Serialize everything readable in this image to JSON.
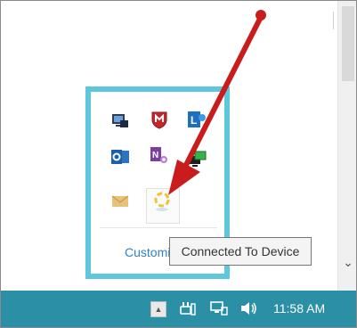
{
  "popup": {
    "customize_label": "Customize",
    "icons": [
      {
        "name": "screen-share-icon"
      },
      {
        "name": "mcafee-shield-icon"
      },
      {
        "name": "lync-icon"
      },
      {
        "name": "outlook-icon"
      },
      {
        "name": "onenote-icon"
      },
      {
        "name": "network-monitor-icon"
      },
      {
        "name": "mail-envelope-icon"
      },
      {
        "name": "device-sync-icon"
      }
    ]
  },
  "tooltip": {
    "text": "Connected To Device"
  },
  "taskbar": {
    "clock": "11:58 AM",
    "show_hidden_icon": "chevron-up-icon"
  },
  "annotation": {
    "arrow_color": "#c91c1c"
  },
  "colors": {
    "taskbar": "#2b8fa6",
    "popup_border": "#5fc7dd",
    "link": "#2f82c4"
  }
}
